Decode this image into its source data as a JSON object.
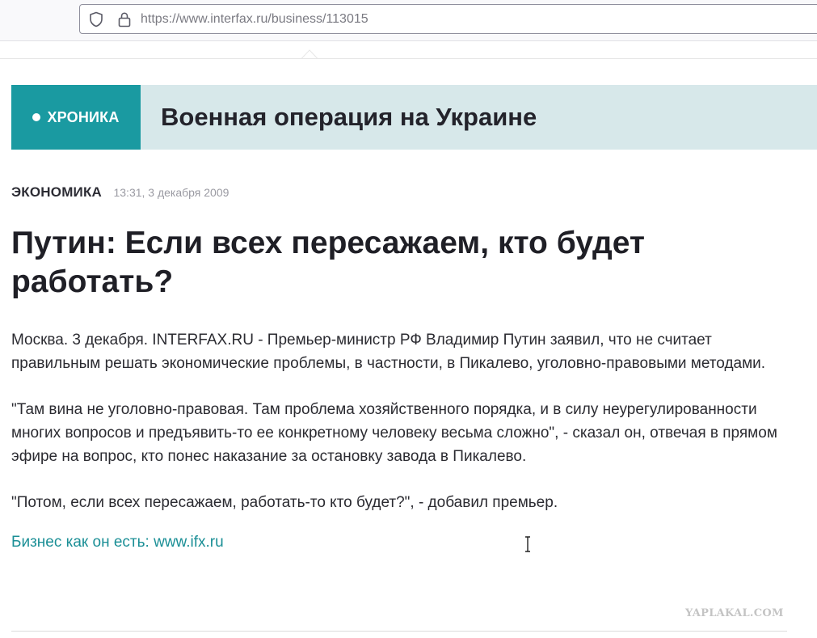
{
  "browser": {
    "url_prefix": "https://www.",
    "url_host": "interfax.ru",
    "url_path": "/business/113015"
  },
  "chronicle": {
    "badge_label": "ХРОНИКА",
    "title": "Военная операция на Украине"
  },
  "article": {
    "rubric": "ЭКОНОМИКА",
    "date": "13:31, 3 декабря 2009",
    "headline": "Путин: Если всех пересажаем, кто будет работать?",
    "paragraphs": [
      "Москва. 3 декабря. INTERFAX.RU - Премьер-министр РФ Владимир Путин заявил, что не считает правильным решать экономические проблемы, в частности, в Пикалево, уголовно-правовыми методами.",
      "\"Там вина не уголовно-правовая. Там проблема хозяйственного порядка, и в силу неурегулированности многих вопросов и предъявить-то ее конкретному человеку весьма сложно\", - сказал он, отвечая в прямом эфире на вопрос, кто понес наказание за остановку завода в Пикалево.",
      "\"Потом, если всех пересажаем, работать-то кто будет?\", - добавил премьер."
    ],
    "footer_link": "Бизнес как он есть: www.ifx.ru"
  },
  "watermark": "YAPLAKAL.COM",
  "colors": {
    "accent": "#1a9aa1",
    "chronicle_bg": "#d7e8ea",
    "link": "#1b8f96"
  },
  "icons": {
    "tracking_protection": "shield-icon",
    "secure_connection": "lock-icon",
    "pointer": "text-cursor-icon"
  }
}
